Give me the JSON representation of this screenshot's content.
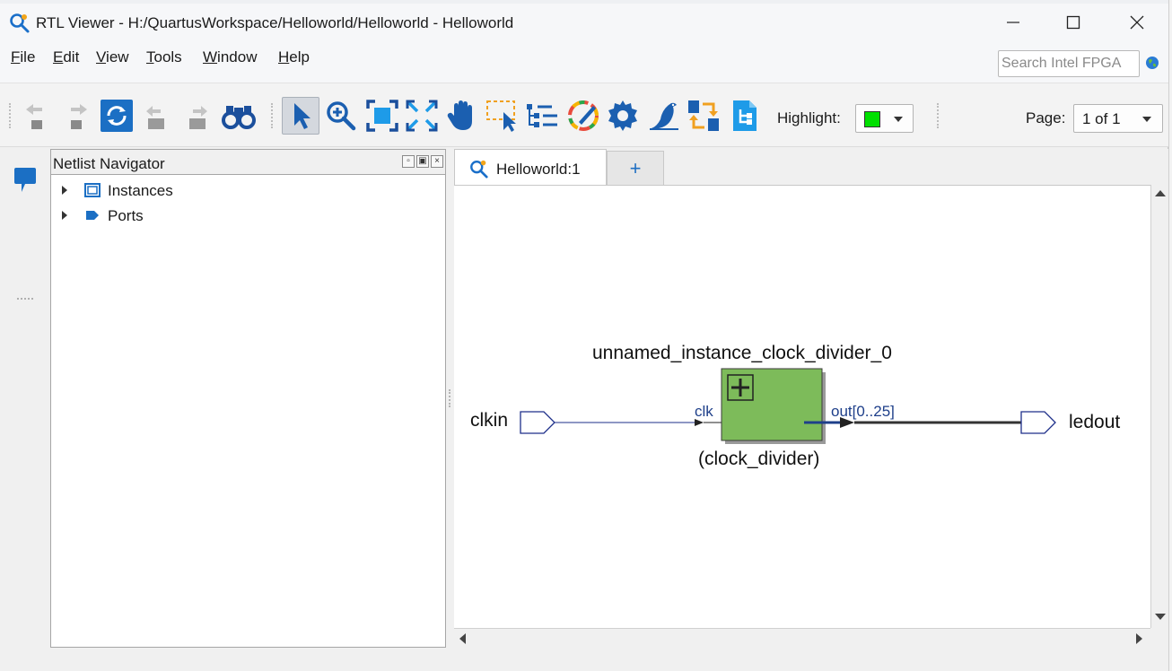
{
  "window": {
    "title": "RTL Viewer - H:/QuartusWorkspace/Helloworld/Helloworld - Helloworld"
  },
  "menu": {
    "items": [
      {
        "key": "F",
        "rest": "ile"
      },
      {
        "key": "E",
        "rest": "dit"
      },
      {
        "key": "V",
        "rest": "iew"
      },
      {
        "key": "T",
        "rest": "ools"
      },
      {
        "key": "W",
        "rest": "indow"
      },
      {
        "key": "H",
        "rest": "elp"
      }
    ],
    "search_placeholder": "Search Intel FPGA"
  },
  "toolbar": {
    "icons": [
      "back-icon",
      "forward-icon",
      "refresh-icon",
      "undo-nav-icon",
      "redo-nav-icon",
      "find-icon",
      "select-icon",
      "zoom-icon",
      "fit-icon",
      "fit-selection-icon",
      "pan-icon",
      "area-select-icon",
      "hierarchy-icon",
      "color-icon",
      "settings-icon",
      "tool-bird-icon",
      "swap-icon",
      "netlist-doc-icon"
    ],
    "highlight_label": "Highlight:",
    "highlight_color": "#00e000",
    "page_label": "Page:",
    "page_value": "1 of 1"
  },
  "navigator": {
    "title": "Netlist Navigator",
    "items": [
      {
        "label": "Instances",
        "icon": "instance-icon"
      },
      {
        "label": "Ports",
        "icon": "port-icon"
      }
    ]
  },
  "tabs": {
    "active_label": "Helloworld:1",
    "add_label": "+"
  },
  "schematic": {
    "instance_name": "unnamed_instance_clock_divider_0",
    "module_name": "(clock_divider)",
    "input_port": "clkin",
    "output_port": "ledout",
    "pin_in": "clk",
    "pin_out": "out[0..25]",
    "block_color": "#7dbb5a",
    "wire_color": "#1e3f8a"
  }
}
